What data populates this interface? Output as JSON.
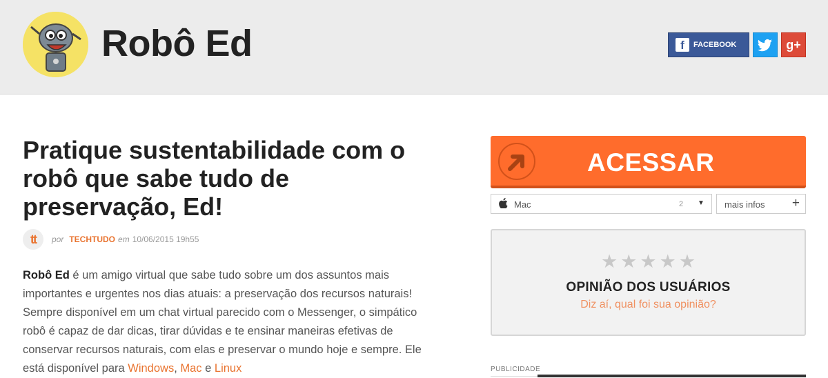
{
  "header": {
    "site_title": "Robô Ed",
    "social": {
      "facebook_label": "FACEBOOK",
      "googleplus_label": "g+"
    }
  },
  "article": {
    "title": "Pratique sustentabilidade com o robô que sabe tudo de preservação, Ed!",
    "byline": {
      "by": "por",
      "source": "TECHTUDO",
      "on": "em",
      "datetime": "10/06/2015 19h55"
    },
    "body": {
      "bold": "Robô Ed",
      "text": " é um amigo virtual que sabe tudo sobre um dos assuntos mais importantes e urgentes nos dias atuais: a preservação dos recursos naturais! Sempre disponível em um chat virtual parecido com o Messenger, o simpático robô é capaz de dar dicas, tirar dúvidas e te ensinar maneiras efetivas de conservar recursos naturais, com elas e preservar o mundo hoje e sempre. Ele está disponível para ",
      "link_windows": "Windows",
      "sep1": ", ",
      "link_mac": "Mac",
      "sep2": " e ",
      "link_linux": "Linux"
    }
  },
  "download": {
    "button_label": "ACESSAR",
    "platform_select": {
      "value": "Mac",
      "count": "2"
    },
    "more_info_label": "mais infos"
  },
  "opinion": {
    "stars": 5,
    "title": "OPINIÃO DOS USUÁRIOS",
    "prompt": "Diz aí, qual foi sua opinião?"
  },
  "ad": {
    "label": "PUBLICIDADE"
  },
  "colors": {
    "accent": "#ff6c2c",
    "facebook": "#3b5998",
    "twitter": "#1da1f2",
    "googleplus": "#dd4b39"
  }
}
